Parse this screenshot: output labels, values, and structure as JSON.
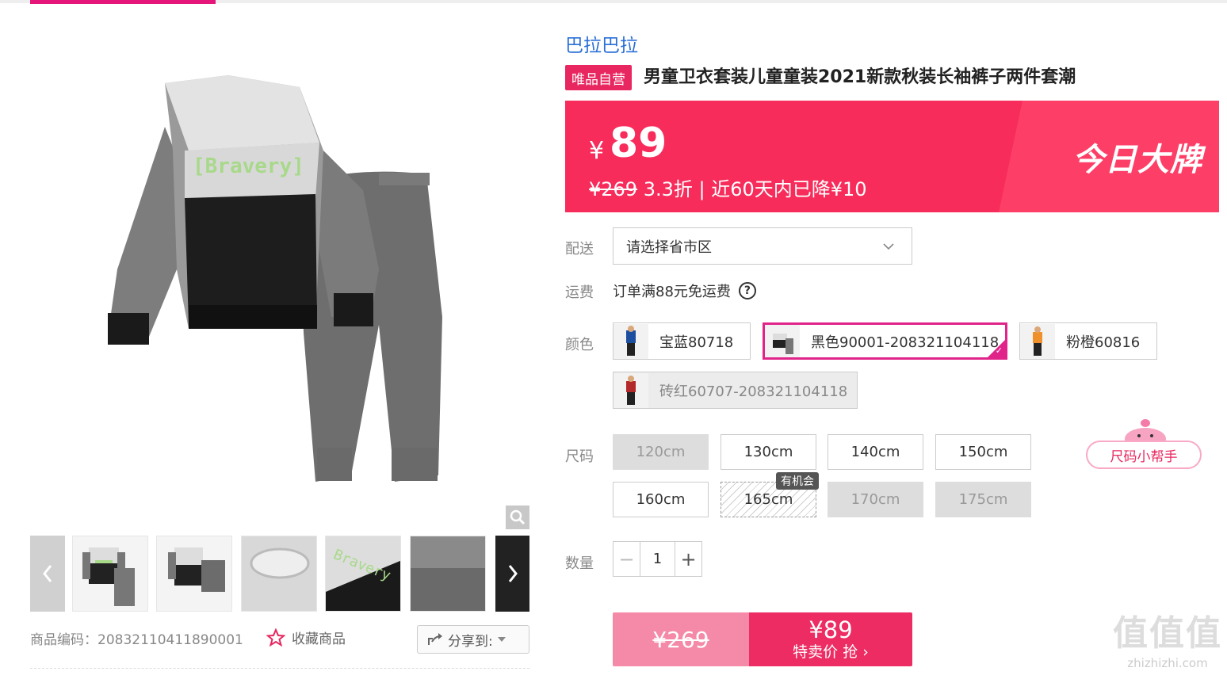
{
  "icons": {
    "zoom": "magnifier-icon",
    "prev": "chevron-left-icon",
    "next": "chevron-right-icon",
    "fav": "star-outline-icon",
    "share": "share-icon",
    "dropdown": "chevron-down-icon",
    "help": "question-circle-icon",
    "check": "check-icon"
  },
  "colors": {
    "accent": "#e8265f",
    "banner": "#f72c5b",
    "brand_link": "#2a6fd6",
    "selected_border": "#e0248a"
  },
  "gallery": {
    "thumbnails": [
      "front-view",
      "set-view",
      "collar-detail",
      "print-detail",
      "cuff-detail"
    ]
  },
  "footer": {
    "sku_code": "商品编码：20832110411890001",
    "favorite": "收藏商品",
    "share": "分享到:"
  },
  "product": {
    "brand": "巴拉巴拉",
    "self_badge": "唯品自营",
    "title": "男童卫衣套装儿童童装2021新款秋装长袖裤子两件套潮"
  },
  "price": {
    "currency": "¥",
    "current": "89",
    "original": "¥269",
    "discount_info": " 3.3折 | 近60天内已降¥10",
    "promo": "今日大牌"
  },
  "delivery": {
    "label": "配送",
    "placeholder": "请选择省市区"
  },
  "shipping": {
    "label": "运费",
    "text": "订单满88元免运费",
    "help": "?"
  },
  "color": {
    "label": "颜色",
    "options": [
      {
        "name": "宝蓝80718"
      },
      {
        "name": "黑色90001-208321104118"
      },
      {
        "name": "粉橙60816"
      },
      {
        "name": "砖红60707-208321104118"
      }
    ]
  },
  "size": {
    "label": "尺码",
    "options": [
      "120cm",
      "130cm",
      "140cm",
      "150cm",
      "160cm",
      "165cm",
      "170cm",
      "175cm"
    ],
    "tooltip": "有机会",
    "helper": "尺码小帮手"
  },
  "quantity": {
    "label": "数量",
    "value": "1",
    "minus": "−",
    "plus": "+"
  },
  "buy": {
    "original": "¥269",
    "price": "¥89",
    "cta": "特卖价 抢 ›"
  },
  "watermark": {
    "big": "值值值",
    "url": "zhizhizhi.com"
  }
}
